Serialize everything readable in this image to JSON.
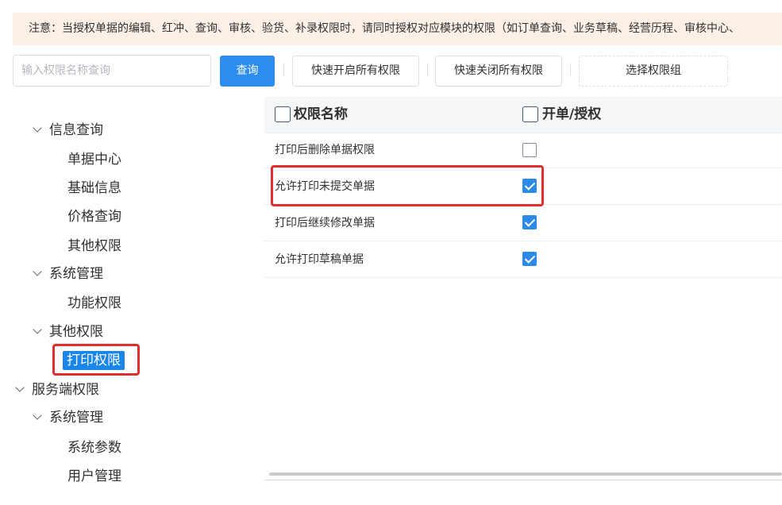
{
  "notice": {
    "text": "注意：当授权单据的编辑、红冲、查询、审核、验货、补录权限时，请同时授权对应模块的权限（如订单查询、业务草稿、经营历程、审核中心、"
  },
  "toolbar": {
    "search_placeholder": "输入权限名称查询",
    "search_value": "",
    "query_label": "查询",
    "open_all_label": "快速开启所有权限",
    "close_all_label": "快速关闭所有权限",
    "select_group_label": "选择权限组"
  },
  "tree": {
    "group_info_query": "信息查询",
    "item_bill_center": "单据中心",
    "item_basic_info": "基础信息",
    "item_price_query": "价格查询",
    "item_other_permissions_1": "其他权限",
    "group_system_mgmt_1": "系统管理",
    "item_function_permissions": "功能权限",
    "group_other_permissions": "其他权限",
    "item_print_permissions": "打印权限",
    "root_server_permissions": "服务端权限",
    "group_system_mgmt_2": "系统管理",
    "item_system_params": "系统参数",
    "item_user_mgmt": "用户管理",
    "selected": "打印权限"
  },
  "table": {
    "col_name": "权限名称",
    "col_auth": "开单/授权",
    "rows": [
      {
        "name": "打印后删除单据权限",
        "checked": false
      },
      {
        "name": "允许打印未提交单据",
        "checked": true
      },
      {
        "name": "打印后继续修改单据",
        "checked": true
      },
      {
        "name": "允许打印草稿单据",
        "checked": true
      }
    ]
  },
  "colors": {
    "primary": "#2d8cf0",
    "checkbox_checked": "#2b8ae6",
    "tree_selected": "#1b86e9",
    "highlight_red": "#e02d2d",
    "notice_bg": "#fdf0e6"
  }
}
